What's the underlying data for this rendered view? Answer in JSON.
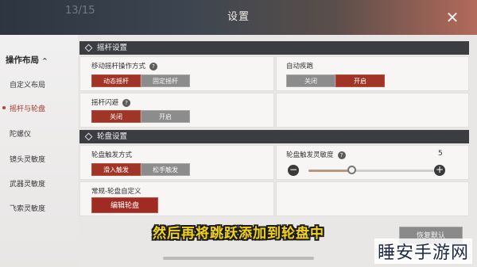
{
  "header": {
    "title": "设置",
    "ghost_text": "13/15",
    "close_label": "✕"
  },
  "sidebar": {
    "section_title": "操作布局",
    "section_chevron": "^",
    "items": [
      {
        "label": "自定义布局",
        "active": false
      },
      {
        "label": "摇杆与轮盘",
        "active": true
      },
      {
        "label": "陀螺仪",
        "active": false
      },
      {
        "label": "镜头灵敏度",
        "active": false
      },
      {
        "label": "武器灵敏度",
        "active": false
      },
      {
        "label": "飞索灵敏度",
        "active": false
      }
    ]
  },
  "joystick_group": {
    "title": "摇杆设置",
    "operation_mode": {
      "label": "移动摇杆操作方式",
      "help": "?",
      "options": [
        "动态摇杆",
        "固定摇杆"
      ],
      "selected": "动态摇杆"
    },
    "auto_run": {
      "label": "自动疾跑",
      "options": [
        "关闭",
        "开启"
      ],
      "selected": "开启"
    },
    "flash_dodge": {
      "label": "摇杆闪避",
      "help": "?",
      "options": [
        "关闭",
        "开启"
      ],
      "selected": "关闭"
    }
  },
  "wheel_group": {
    "title": "轮盘设置",
    "trigger_mode": {
      "label": "轮盘触发方式",
      "options": [
        "滑入触发",
        "松手触发"
      ],
      "selected": "滑入触发"
    },
    "trigger_sensitivity": {
      "label": "轮盘触发灵敏度",
      "help": "?",
      "value": "5",
      "fraction": 0.35,
      "minus": "−",
      "plus": "+"
    },
    "custom": {
      "label": "常规-轮盘自定义",
      "button": "编辑轮盘"
    }
  },
  "subtitle": "然后再将跳跃添加到轮盘中",
  "restore_button": "恢复默认",
  "watermark": "睡安手游网",
  "colors": {
    "accent": "#9f3427",
    "header_bg": "#3b3d40",
    "subtitle": "#f3d21a"
  }
}
